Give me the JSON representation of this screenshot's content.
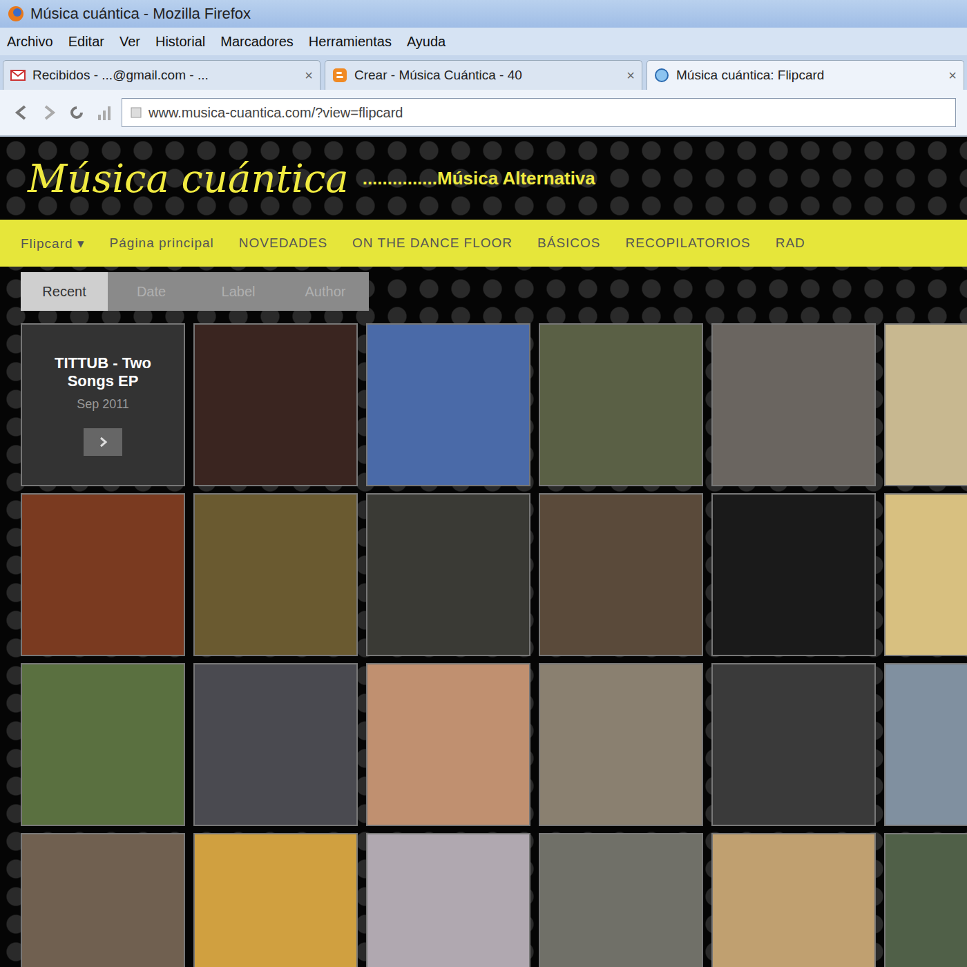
{
  "window": {
    "title": "Música cuántica - Mozilla Firefox"
  },
  "menu": [
    "Archivo",
    "Editar",
    "Ver",
    "Historial",
    "Marcadores",
    "Herramientas",
    "Ayuda"
  ],
  "tab_close": "×",
  "tabs": [
    {
      "label": "Recibidos - ...@gmail.com - ...",
      "selected": false,
      "kind": "gmail"
    },
    {
      "label": "Crear - Música Cuántica - 40",
      "selected": false,
      "kind": "blogger"
    },
    {
      "label": "Música cuántica: Flipcard",
      "selected": true,
      "kind": "help"
    }
  ],
  "address": {
    "url": "www.musica-cuantica.com/?view=flipcard"
  },
  "blog": {
    "title": "Música cuántica",
    "subtitle": "...............Música Alternativa"
  },
  "nav": [
    {
      "label": "Flipcard",
      "caret": "▾"
    },
    {
      "label": "Página principal"
    },
    {
      "label": "NOVEDADES"
    },
    {
      "label": "ON THE DANCE FLOOR"
    },
    {
      "label": "BÁSICOS"
    },
    {
      "label": "RECOPILATORIOS"
    },
    {
      "label": "RAD"
    }
  ],
  "view_tabs": [
    {
      "label": "Recent",
      "selected": true
    },
    {
      "label": "Date",
      "selected": false
    },
    {
      "label": "Label",
      "selected": false
    },
    {
      "label": "Author",
      "selected": false
    }
  ],
  "cards": [
    {
      "kind": "text",
      "title": "TITTUB - Two Songs EP",
      "date": "Sep 2011",
      "color": "#333333"
    },
    {
      "kind": "photo",
      "color": "#3a2520"
    },
    {
      "kind": "photo",
      "color": "#4a6aa8"
    },
    {
      "kind": "photo",
      "color": "#5a6045"
    },
    {
      "kind": "photo",
      "color": "#6a6560"
    },
    {
      "kind": "photo",
      "color": "#c8b890"
    },
    {
      "kind": "photo",
      "color": "#7a3a20"
    },
    {
      "kind": "photo",
      "color": "#6a5a30"
    },
    {
      "kind": "photo",
      "color": "#3a3a35"
    },
    {
      "kind": "photo",
      "color": "#5a4a3a"
    },
    {
      "kind": "photo",
      "color": "#1a1a1a"
    },
    {
      "kind": "photo",
      "color": "#d8c080"
    },
    {
      "kind": "photo",
      "color": "#5a7040"
    },
    {
      "kind": "photo",
      "color": "#4a4a50"
    },
    {
      "kind": "photo",
      "color": "#c09070"
    },
    {
      "kind": "photo",
      "color": "#8a8070"
    },
    {
      "kind": "photo",
      "color": "#3a3a3a"
    },
    {
      "kind": "photo",
      "color": "#8090a0"
    },
    {
      "kind": "photo",
      "color": "#706050"
    },
    {
      "kind": "photo",
      "color": "#d0a040"
    },
    {
      "kind": "photo",
      "color": "#b0a8b0"
    },
    {
      "kind": "photo",
      "color": "#707068"
    },
    {
      "kind": "photo",
      "color": "#c0a070"
    },
    {
      "kind": "photo",
      "color": "#506048"
    }
  ]
}
